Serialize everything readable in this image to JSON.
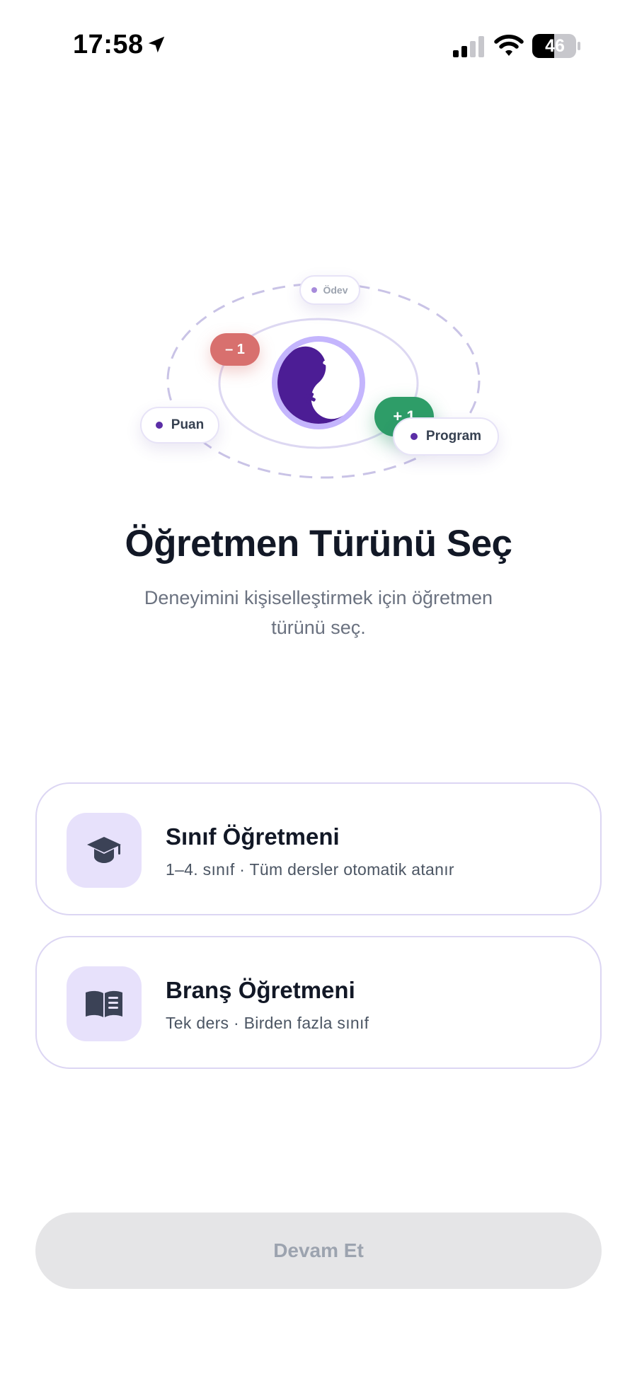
{
  "status_bar": {
    "time": "17:58",
    "battery": "46",
    "icons": [
      "location-arrow-icon",
      "cellular-signal-icon",
      "wifi-icon",
      "battery-icon"
    ]
  },
  "illustration": {
    "chips": {
      "odev": "Ödev",
      "puan": "Puan",
      "program": "Program",
      "minus": "– 1",
      "plus": "+ 1"
    },
    "center_icon": "yin-yang-plus-minus-icon",
    "colors": {
      "purple": "#4c1d95",
      "ring": "#c4b5fd",
      "minus": "#d8706e",
      "plus": "#2e9d68"
    }
  },
  "header": {
    "title": "Öğretmen Türünü Seç",
    "subtitle": "Deneyimini kişiselleştirmek için öğretmen türünü seç."
  },
  "options": [
    {
      "title": "Sınıf Öğretmeni",
      "subtitle": "1–4. sınıf · Tüm dersler otomatik atanır",
      "icon": "graduation-cap-icon"
    },
    {
      "title": "Branş Öğretmeni",
      "subtitle": "Tek ders · Birden fazla sınıf",
      "icon": "open-book-icon"
    }
  ],
  "footer": {
    "continue_label": "Devam Et"
  }
}
